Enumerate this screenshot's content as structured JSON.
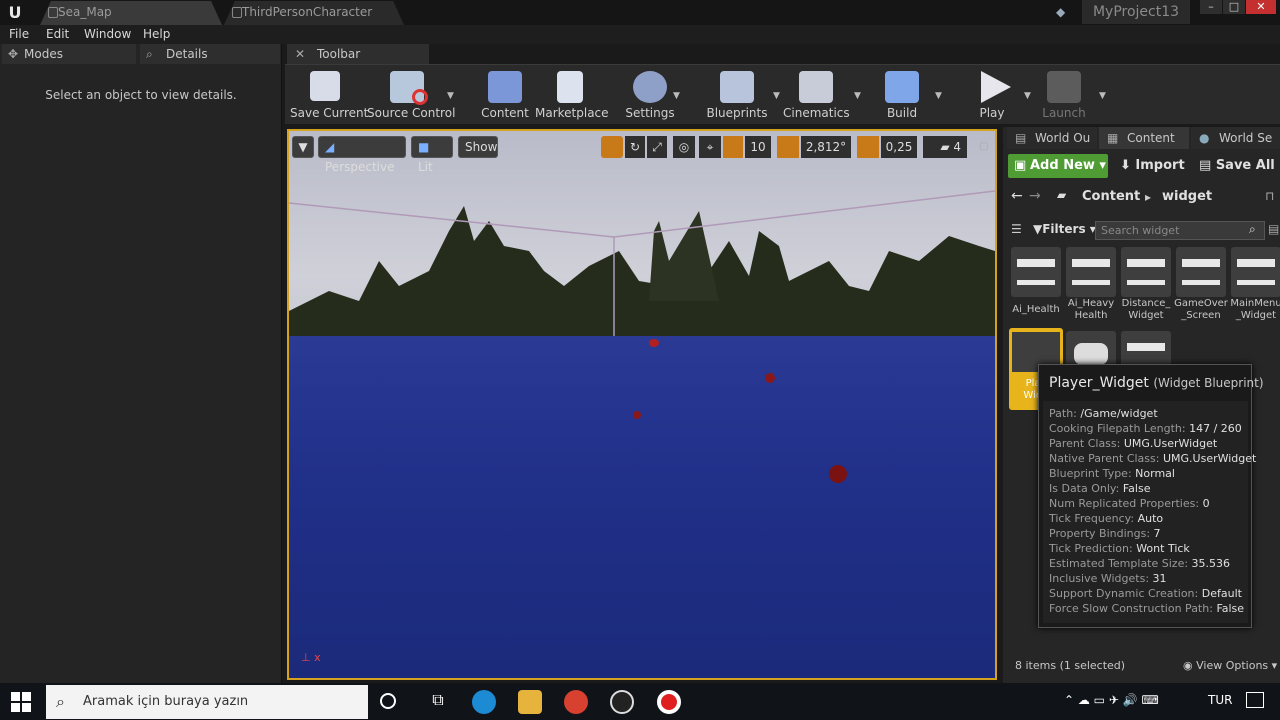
{
  "titlebar": {
    "tabs": [
      {
        "label": "Sea_Map"
      },
      {
        "label": "ThirdPersonCharacter"
      }
    ],
    "project_name": "MyProject13",
    "window_buttons": {
      "minimize": "–",
      "maximize": "□",
      "close": "✕"
    }
  },
  "menu": {
    "items": [
      {
        "label": "File"
      },
      {
        "label": "Edit"
      },
      {
        "label": "Window"
      },
      {
        "label": "Help"
      }
    ]
  },
  "left_panel": {
    "tabs": [
      {
        "label": "Modes"
      },
      {
        "label": "Details"
      }
    ],
    "empty_message": "Select an object to view details."
  },
  "toolbar": {
    "tab_label": "Toolbar",
    "buttons": [
      {
        "label": "Save Current"
      },
      {
        "label": "Source Control"
      },
      {
        "label": "Content"
      },
      {
        "label": "Marketplace"
      },
      {
        "label": "Settings"
      },
      {
        "label": "Blueprints"
      },
      {
        "label": "Cinematics"
      },
      {
        "label": "Build"
      },
      {
        "label": "Play"
      },
      {
        "label": "Launch"
      }
    ]
  },
  "viewport": {
    "view_mode": "Perspective",
    "lighting": "Lit",
    "show_label": "Show",
    "grid_snap": "10",
    "rotation_snap": "2,812°",
    "scale_snap": "0,25",
    "camera_speed": "4"
  },
  "content_browser": {
    "tabs": [
      {
        "label": "World Ou"
      },
      {
        "label": "Content"
      },
      {
        "label": "World Se"
      }
    ],
    "add_new_label": "Add New",
    "import_label": "Import",
    "save_all_label": "Save All",
    "path": [
      "Content",
      "widget"
    ],
    "filters_label": "Filters",
    "search_placeholder": "Search widget",
    "assets": [
      {
        "line1": "Ai_Health",
        "line2": ""
      },
      {
        "line1": "Ai_Heavy",
        "line2": "Health"
      },
      {
        "line1": "Distance_",
        "line2": "Widget"
      },
      {
        "line1": "GameOver",
        "line2": "_Screen"
      },
      {
        "line1": "MainMenu",
        "line2": "_Widget"
      },
      {
        "line1": "Play",
        "line2": "Widg"
      },
      {
        "line1": "",
        "line2": ""
      },
      {
        "line1": "",
        "line2": ""
      }
    ],
    "status": "8 items (1 selected)",
    "view_options": "View Options"
  },
  "tooltip": {
    "title": "Player_Widget",
    "subtitle": "(Widget Blueprint)",
    "rows": [
      {
        "key": "Path:",
        "value": "/Game/widget"
      },
      {
        "key": "Cooking Filepath Length:",
        "value": "147 / 260"
      },
      {
        "key": "Parent Class:",
        "value": "UMG.UserWidget"
      },
      {
        "key": "Native Parent Class:",
        "value": "UMG.UserWidget"
      },
      {
        "key": "Blueprint Type:",
        "value": "Normal"
      },
      {
        "key": "Is Data Only:",
        "value": "False"
      },
      {
        "key": "Num Replicated Properties:",
        "value": "0"
      },
      {
        "key": "Tick Frequency:",
        "value": "Auto"
      },
      {
        "key": "Property Bindings:",
        "value": "7"
      },
      {
        "key": "Tick Prediction:",
        "value": "Wont Tick"
      },
      {
        "key": "Estimated Template Size:",
        "value": "35.536"
      },
      {
        "key": "Inclusive Widgets:",
        "value": "31"
      },
      {
        "key": "Support Dynamic Creation:",
        "value": "Default"
      },
      {
        "key": "Force Slow Construction Path:",
        "value": "False"
      }
    ]
  },
  "taskbar": {
    "search_placeholder": "Aramak için buraya yazın",
    "language": "TUR"
  },
  "colors": {
    "accent_orange": "#d4a21f",
    "add_new_green": "#4f9b34",
    "water": "#213089",
    "selected_asset": "#e8b41c"
  }
}
